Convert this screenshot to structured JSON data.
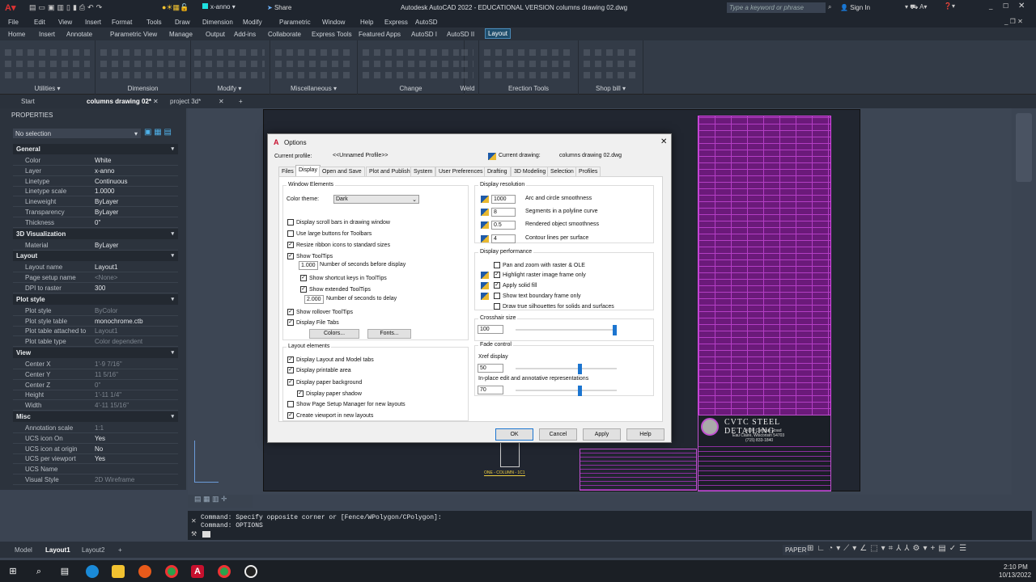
{
  "app": {
    "title": "Autodesk AutoCAD 2022 - EDUCATIONAL VERSION    columns drawing 02.dwg",
    "layer_dropdown": "x-anno",
    "share": "Share",
    "search_placeholder": "Type a keyword or phrase",
    "sign_in": "Sign In"
  },
  "menu": [
    "File",
    "Edit",
    "View",
    "Insert",
    "Format",
    "Tools",
    "Draw",
    "Dimension",
    "Modify",
    "Parametric",
    "Window",
    "Help",
    "Express",
    "AutoSD"
  ],
  "ribbon_tabs": [
    "Home",
    "Insert",
    "Annotate",
    "Parametric",
    "View",
    "Manage",
    "Output",
    "Add-ins",
    "Collaborate",
    "Express Tools",
    "Featured Apps",
    "AutoSD I",
    "AutoSD II",
    "Layout"
  ],
  "ribbon_active": "Layout",
  "ribbon_panels": [
    "Utilities ▾",
    "Dimension",
    "Modify ▾",
    "Miscellaneous ▾",
    "Change",
    "Weld",
    "Erection Tools",
    "Shop bill ▾"
  ],
  "doc_tabs": [
    "Start",
    "columns drawing 02*",
    "project 3d*"
  ],
  "properties": {
    "title": "PROPERTIES",
    "selection": "No selection",
    "sections": [
      {
        "name": "General",
        "rows": [
          [
            "Color",
            "White",
            ""
          ],
          [
            "Layer",
            "x-anno",
            ""
          ],
          [
            "Linetype",
            "Continuous",
            ""
          ],
          [
            "Linetype scale",
            "1.0000",
            ""
          ],
          [
            "Lineweight",
            "ByLayer",
            ""
          ],
          [
            "Transparency",
            "ByLayer",
            ""
          ],
          [
            "Thickness",
            "0\"",
            ""
          ]
        ]
      },
      {
        "name": "3D Visualization",
        "rows": [
          [
            "Material",
            "ByLayer",
            ""
          ]
        ]
      },
      {
        "name": "Layout",
        "rows": [
          [
            "Layout name",
            "Layout1",
            ""
          ],
          [
            "Page setup name",
            "<None>",
            "dim"
          ],
          [
            "DPI to raster",
            "300",
            ""
          ]
        ]
      },
      {
        "name": "Plot style",
        "rows": [
          [
            "Plot style",
            "ByColor",
            "dim"
          ],
          [
            "Plot style table",
            "monochrome.ctb",
            ""
          ],
          [
            "Plot table attached to",
            "Layout1",
            "dim"
          ],
          [
            "Plot table type",
            "Color dependent",
            "dim"
          ]
        ]
      },
      {
        "name": "View",
        "rows": [
          [
            "Center X",
            "1'-9 7/16\"",
            "dim"
          ],
          [
            "Center Y",
            "11 5/16\"",
            "dim"
          ],
          [
            "Center Z",
            "0\"",
            "dim"
          ],
          [
            "Height",
            "1'-11 1/4\"",
            "dim"
          ],
          [
            "Width",
            "4'-11 15/16\"",
            "dim"
          ]
        ]
      },
      {
        "name": "Misc",
        "rows": [
          [
            "Annotation scale",
            "1:1",
            "dim"
          ],
          [
            "UCS icon On",
            "Yes",
            ""
          ],
          [
            "UCS icon at origin",
            "No",
            ""
          ],
          [
            "UCS per viewport",
            "Yes",
            ""
          ],
          [
            "UCS Name",
            "",
            ""
          ],
          [
            "Visual Style",
            "2D Wireframe",
            "dim"
          ]
        ]
      }
    ]
  },
  "drawing": {
    "company": "CVTC STEEL DETAILING",
    "address1": "4000 Campus Road",
    "address2": "Eau Claire, Wisconsin 54703",
    "phone": "(715) 833-1840",
    "column_label": "ONE - COLUMN - 1C1"
  },
  "dialog": {
    "title": "Options",
    "profile_label": "Current profile:",
    "profile": "<<Unnamed Profile>>",
    "drawing_label": "Current drawing:",
    "drawing": "columns drawing 02.dwg",
    "tabs": [
      "Files",
      "Display",
      "Open and Save",
      "Plot and Publish",
      "System",
      "User Preferences",
      "Drafting",
      "3D Modeling",
      "Selection",
      "Profiles"
    ],
    "active_tab": "Display",
    "window_elements": {
      "label": "Window Elements",
      "color_theme_label": "Color theme:",
      "color_theme": "Dark",
      "checks": [
        [
          "Display scroll bars in drawing window",
          false
        ],
        [
          "Use large buttons for Toolbars",
          false
        ],
        [
          "Resize ribbon icons to standard sizes",
          true
        ],
        [
          "Show ToolTips",
          true
        ]
      ],
      "tooltip_seconds": "1.000",
      "tooltip_seconds_label": "Number of seconds before display",
      "sub_checks": [
        [
          "Show shortcut keys in ToolTips",
          true
        ],
        [
          "Show extended ToolTips",
          true
        ]
      ],
      "delay_seconds": "2.000",
      "delay_label": "Number of seconds to delay",
      "checks2": [
        [
          "Show rollover ToolTips",
          true
        ],
        [
          "Display File Tabs",
          true
        ]
      ],
      "colors_btn": "Colors...",
      "fonts_btn": "Fonts..."
    },
    "layout_elements": {
      "label": "Layout elements",
      "checks": [
        [
          "Display Layout and Model tabs",
          true
        ],
        [
          "Display printable area",
          true
        ],
        [
          "Display paper background",
          true
        ],
        [
          "Display paper shadow",
          true
        ],
        [
          "Show Page Setup Manager for new layouts",
          false
        ],
        [
          "Create viewport in new layouts",
          true
        ]
      ]
    },
    "display_resolution": {
      "label": "Display resolution",
      "rows": [
        [
          "1000",
          "Arc and circle smoothness"
        ],
        [
          "8",
          "Segments in a polyline curve"
        ],
        [
          "0.5",
          "Rendered object smoothness"
        ],
        [
          "4",
          "Contour lines per surface"
        ]
      ]
    },
    "display_performance": {
      "label": "Display performance",
      "checks": [
        [
          "Pan and zoom with raster & OLE",
          false
        ],
        [
          "Highlight raster image frame only",
          true
        ],
        [
          "Apply solid fill",
          true
        ],
        [
          "Show text boundary frame only",
          false
        ],
        [
          "Draw true silhouettes for solids and surfaces",
          false
        ]
      ]
    },
    "crosshair": {
      "label": "Crosshair size",
      "value": "100",
      "fraction": 1.0
    },
    "fade": {
      "label": "Fade control",
      "xref_label": "Xref display",
      "xref": "50",
      "xref_fraction": 0.75,
      "inplace_label": "In-place edit and annotative representations",
      "inplace": "70",
      "inplace_fraction": 0.75
    },
    "buttons": {
      "ok": "OK",
      "cancel": "Cancel",
      "apply": "Apply",
      "help": "Help"
    }
  },
  "command": {
    "line1": "Command: Specify opposite corner or [Fence/WPolygon/CPolygon]:",
    "line2": "Command: OPTIONS"
  },
  "layout_tabs": [
    "Model",
    "Layout1",
    "Layout2"
  ],
  "status": {
    "paper": "PAPER"
  },
  "clock": {
    "time": "2:10 PM",
    "date": "10/13/2022"
  },
  "colors": {
    "accent": "#1f4e6c",
    "magenta": "#b33ec4",
    "autocad_red": "#c8102e"
  }
}
